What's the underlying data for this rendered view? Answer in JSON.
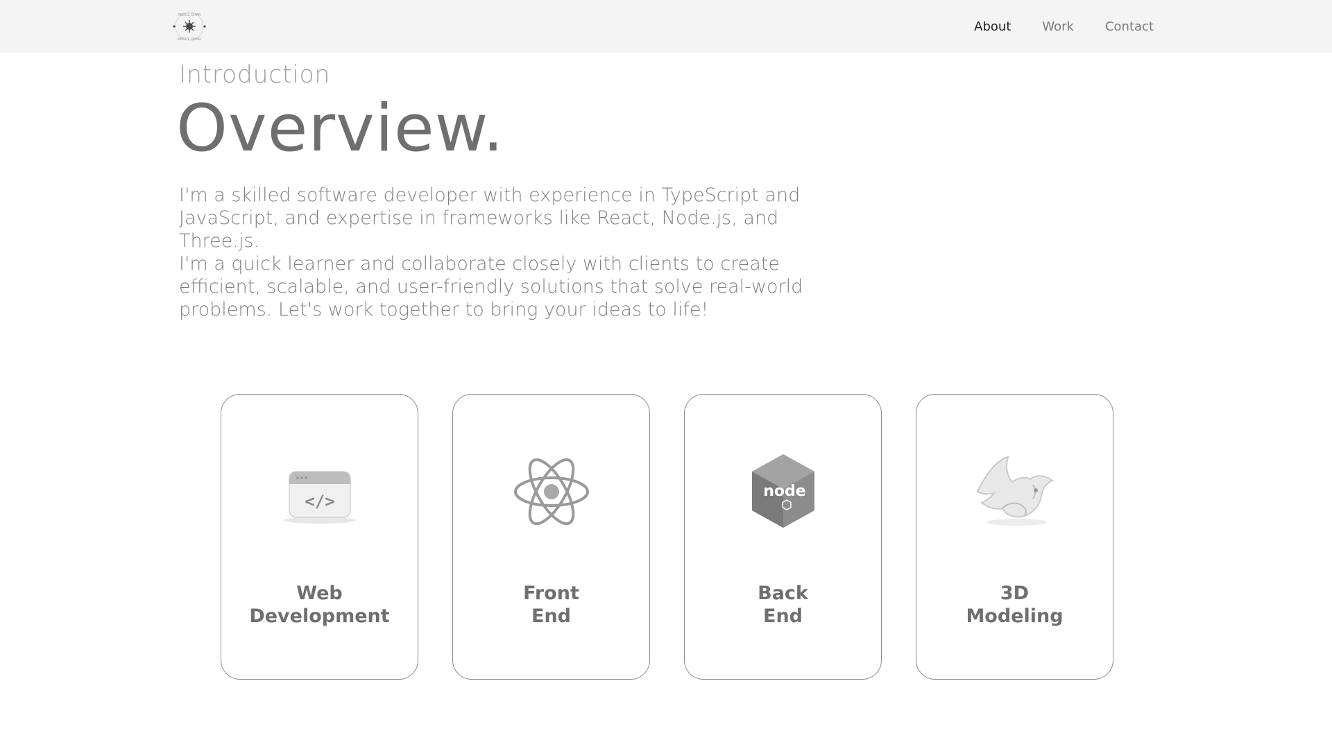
{
  "nav": {
    "logo_text": "ABDUL QHAR",
    "links": [
      {
        "label": "About",
        "active": true
      },
      {
        "label": "Work",
        "active": false
      },
      {
        "label": "Contact",
        "active": false
      }
    ]
  },
  "hero": {
    "subtitle": "Introduction",
    "title": "Overview.",
    "description_lines": [
      "I'm a skilled software developer with experience in TypeScript and",
      "JavaScript, and expertise in frameworks like React, Node.js, and Three.js.",
      "I'm a quick learner and collaborate closely with clients to create",
      "efficient, scalable, and user-friendly solutions that solve real-world",
      "problems. Let's work together to bring your ideas to life!"
    ]
  },
  "services": [
    {
      "title_line1": "Web",
      "title_line2": "Development",
      "icon": "code-window-icon"
    },
    {
      "title_line1": "Front",
      "title_line2": "End",
      "icon": "react-atom-icon"
    },
    {
      "title_line1": "Back",
      "title_line2": "End",
      "icon": "nodejs-hexagon-icon"
    },
    {
      "title_line1": "3D",
      "title_line2": "Modeling",
      "icon": "rhino-3d-icon"
    }
  ],
  "icon_labels": {
    "code": "</>",
    "node": "node"
  }
}
